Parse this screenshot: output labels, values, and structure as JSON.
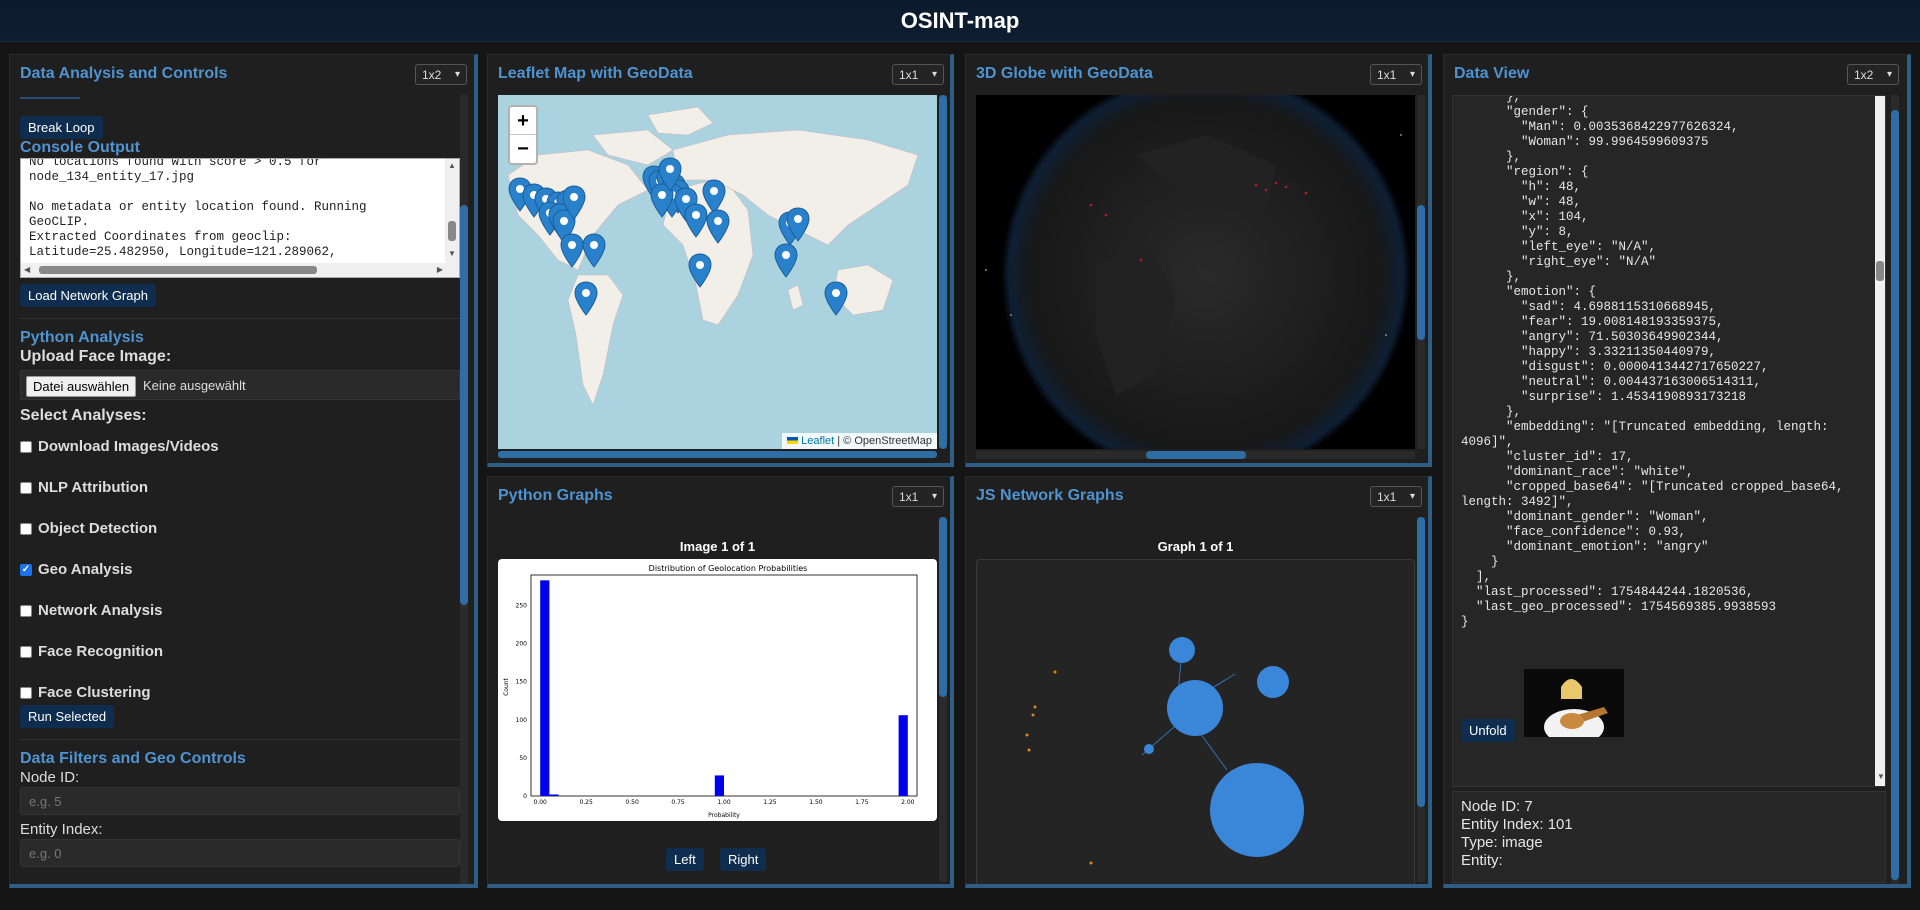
{
  "app": {
    "title": "OSINT-map"
  },
  "controls": {
    "title": "Data Analysis and Controls",
    "layout": "1x2",
    "break_loop": "Break Loop",
    "console_title": "Console Output",
    "console_lines": [
      "No locations found with score > 0.5 for",
      "node_134_entity_17.jpg",
      "",
      "No metadata or entity location found. Running",
      "GeoCLIP.",
      "Extracted Coordinates from geoclip:",
      "Latitude=25.482950, Longitude=121.289062,"
    ],
    "load_network": "Load Network Graph",
    "python_title": "Python Analysis",
    "upload_label": "Upload Face Image:",
    "file_button": "Datei auswählen",
    "file_status": "Keine ausgewählt",
    "select_label": "Select Analyses:",
    "analyses": [
      {
        "label": "Download Images/Videos",
        "checked": false
      },
      {
        "label": "NLP Attribution",
        "checked": false
      },
      {
        "label": "Object Detection",
        "checked": false
      },
      {
        "label": "Geo Analysis",
        "checked": true
      },
      {
        "label": "Network Analysis",
        "checked": false
      },
      {
        "label": "Face Recognition",
        "checked": false
      },
      {
        "label": "Face Clustering",
        "checked": false
      }
    ],
    "run_selected": "Run Selected",
    "filters_title": "Data Filters and Geo Controls",
    "node_id_label": "Node ID:",
    "node_id_placeholder": "e.g. 5",
    "entity_label": "Entity Index:",
    "entity_placeholder": "e.g. 0"
  },
  "leaflet": {
    "title": "Leaflet Map with GeoData",
    "layout": "1x1",
    "zoom_in": "+",
    "zoom_out": "−",
    "attr_leaflet": "Leaflet",
    "attr_osm": "| © OpenStreetMap"
  },
  "globe": {
    "title": "3D Globe with GeoData",
    "layout": "1x1"
  },
  "pygraphs": {
    "title": "Python Graphs",
    "layout": "1x1",
    "counter": "Image 1 of 1",
    "left": "Left",
    "right": "Right"
  },
  "jsnet": {
    "title": "JS Network Graphs",
    "layout": "1x1",
    "counter": "Graph 1 of 1"
  },
  "dataview": {
    "title": "Data View",
    "layout": "1x2",
    "json_lines": [
      "      },",
      "      \"gender\": {",
      "        \"Man\": 0.0035368422977626324,",
      "        \"Woman\": 99.9964599609375",
      "      },",
      "      \"region\": {",
      "        \"h\": 48,",
      "        \"w\": 48,",
      "        \"x\": 104,",
      "        \"y\": 8,",
      "        \"left_eye\": \"N/A\",",
      "        \"right_eye\": \"N/A\"",
      "      },",
      "      \"emotion\": {",
      "        \"sad\": 4.6988115310668945,",
      "        \"fear\": 19.008148193359375,",
      "        \"angry\": 71.50303649902344,",
      "        \"happy\": 3.33211350440979,",
      "        \"disgust\": 0.0000413442717650227,",
      "        \"neutral\": 0.004437163006514311,",
      "        \"surprise\": 1.4534190893173218",
      "      },",
      "      \"embedding\": \"[Truncated embedding, length:",
      "4096]\",",
      "      \"cluster_id\": 17,",
      "      \"dominant_race\": \"white\",",
      "      \"cropped_base64\": \"[Truncated cropped_base64,",
      "length: 3492]\",",
      "      \"dominant_gender\": \"Woman\",",
      "      \"face_confidence\": 0.93,",
      "      \"dominant_emotion\": \"angry\"",
      "    }",
      "  ],",
      "  \"last_processed\": 1754844244.1820536,",
      "  \"last_geo_processed\": 1754569385.9938593",
      "}"
    ],
    "unfold": "Unfold",
    "node_id": "Node ID: 7",
    "entity_index": "Entity Index: 101",
    "type": "Type: image",
    "entity": "Entity:"
  },
  "chart_data": {
    "type": "bar",
    "title": "Distribution of Geolocation Probabilities",
    "xlabel": "Probability",
    "ylabel": "Count",
    "xlim": [
      -0.05,
      2.05
    ],
    "ylim": [
      0,
      290
    ],
    "xticks": [
      "0.00",
      "0.25",
      "0.50",
      "0.75",
      "1.00",
      "1.25",
      "1.50",
      "1.75",
      "2.00"
    ],
    "yticks": [
      "0",
      "50",
      "100",
      "150",
      "200",
      "250"
    ],
    "bin_width": 0.05,
    "bins": [
      {
        "x": 0.025,
        "count": 283
      },
      {
        "x": 0.075,
        "count": 2
      },
      {
        "x": 0.975,
        "count": 27
      },
      {
        "x": 1.975,
        "count": 106
      }
    ],
    "color": "#0000ee"
  },
  "colors": {
    "accent": "#4f93d1",
    "button": "#0f2d4f",
    "water": "#aad3df",
    "land": "#f2efe9",
    "pin": "#2a81cb",
    "node": "#3a86d8"
  }
}
